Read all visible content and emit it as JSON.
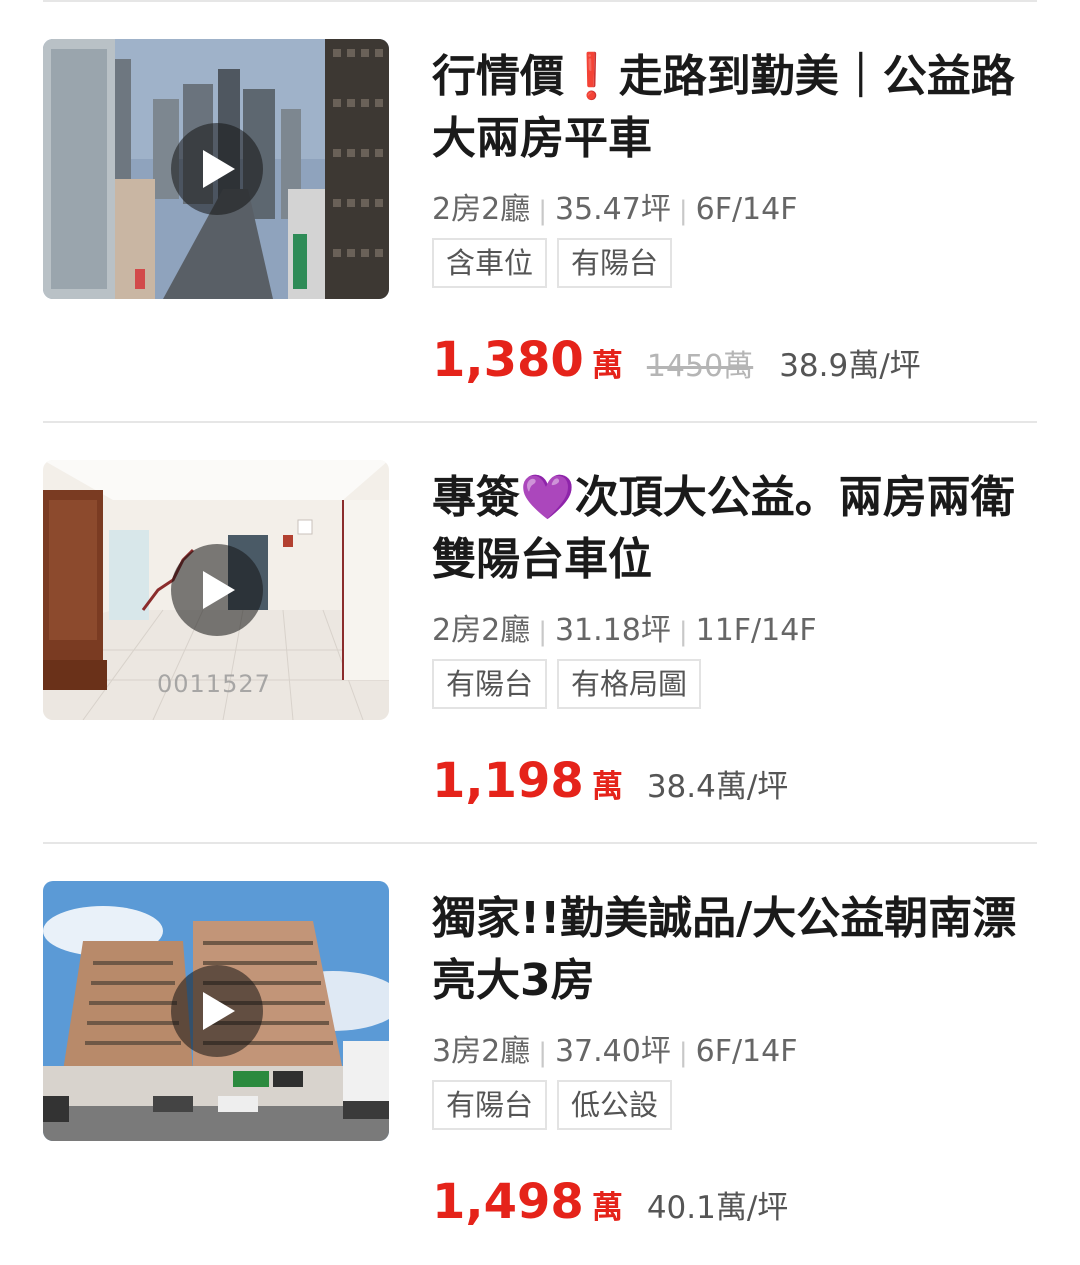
{
  "listings": [
    {
      "title": "行情價❗走路到勤美｜公益路大兩房平車",
      "specs": {
        "layout": "2房2廳",
        "size": "35.47坪",
        "floor": "6F/14F"
      },
      "tags": [
        "含車位",
        "有陽台"
      ],
      "price": "1,380",
      "price_unit": "萬",
      "original_price": "1450萬",
      "unit_price": "38.9萬/坪",
      "thumbnail": "street-view-photo",
      "has_video": true
    },
    {
      "title": "專簽💜次頂大公益。兩房兩衛雙陽台車位",
      "specs": {
        "layout": "2房2廳",
        "size": "31.18坪",
        "floor": "11F/14F"
      },
      "tags": [
        "有陽台",
        "有格局圖"
      ],
      "price": "1,198",
      "price_unit": "萬",
      "original_price": "",
      "unit_price": "38.4萬/坪",
      "thumbnail": "interior-room-photo",
      "watermark": "0011527",
      "has_video": true
    },
    {
      "title": "獨家!!勤美誠品/大公益朝南漂亮大3房",
      "specs": {
        "layout": "3房2廳",
        "size": "37.40坪",
        "floor": "6F/14F"
      },
      "tags": [
        "有陽台",
        "低公設"
      ],
      "price": "1,498",
      "price_unit": "萬",
      "original_price": "",
      "unit_price": "40.1萬/坪",
      "thumbnail": "building-exterior-photo",
      "has_video": true
    }
  ],
  "colors": {
    "price": "#e5231a",
    "title": "#1a1a1a",
    "meta": "#666666",
    "divider": "#e6e6e6"
  },
  "icons": {
    "play": "play-icon"
  }
}
